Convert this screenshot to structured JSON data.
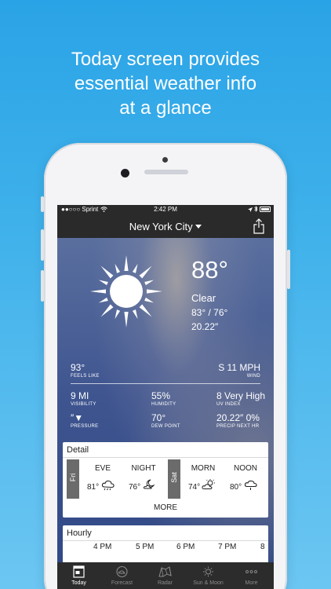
{
  "promo": {
    "headline_lines": [
      "Today screen provides",
      "essential weather info",
      "at a glance"
    ]
  },
  "status_bar": {
    "carrier": "●●○○○ Sprint",
    "time": "2:42 PM"
  },
  "header": {
    "city": "New York City",
    "city_dropdown_icon": "caret-down-icon",
    "share_icon": "share-icon"
  },
  "current": {
    "icon": "sun-icon",
    "temperature": "88°",
    "condition": "Clear",
    "hi_lo": "83° / 76°",
    "pressure_value": "20.22″"
  },
  "stats": {
    "feels_like": {
      "value": "93°",
      "label": "FEELS LIKE"
    },
    "wind": {
      "value": "S 11 MPH",
      "label": "WIND"
    },
    "visibility": {
      "value": "9 MI",
      "label": "VISIBILITY"
    },
    "humidity": {
      "value": "55%",
      "label": "HUMIDITY"
    },
    "uv_index": {
      "value": "8 Very High",
      "label": "UV INDEX"
    },
    "pressure": {
      "value": "″▼",
      "label": "PRESSURE"
    },
    "dew_point": {
      "value": "70°",
      "label": "DEW POINT"
    },
    "precip": {
      "value": "20.22″ 0%",
      "label": "PRECIP NEXT HR"
    }
  },
  "detail": {
    "title": "Detail",
    "days": [
      {
        "day": "Fri",
        "periods": [
          {
            "label": "EVE",
            "temp": "81°",
            "icon": "cloud-rain-icon"
          },
          {
            "label": "NIGHT",
            "temp": "76°",
            "icon": "moon-cloud-icon"
          }
        ]
      },
      {
        "day": "Sat",
        "periods": [
          {
            "label": "MORN",
            "temp": "74°",
            "icon": "sun-cloud-icon"
          },
          {
            "label": "NOON",
            "temp": "80°",
            "icon": "cloud-drizzle-icon"
          }
        ]
      }
    ],
    "more_label": "MORE"
  },
  "hourly": {
    "title": "Hourly",
    "hours": [
      "4 PM",
      "5 PM",
      "6 PM",
      "7 PM",
      "8"
    ]
  },
  "tabbar": {
    "tabs": [
      {
        "label": "Today",
        "icon": "today-icon",
        "active": true
      },
      {
        "label": "Forecast",
        "icon": "forecast-icon",
        "active": false
      },
      {
        "label": "Radar",
        "icon": "radar-icon",
        "active": false
      },
      {
        "label": "Sun & Moon",
        "icon": "sun-moon-icon",
        "active": false
      },
      {
        "label": "More",
        "icon": "more-icon",
        "active": false
      }
    ]
  },
  "colors": {
    "background": "#3db0ea",
    "bar": "#2a2a2a",
    "card": "#ffffff",
    "day_tab": "#6b6b6b"
  }
}
